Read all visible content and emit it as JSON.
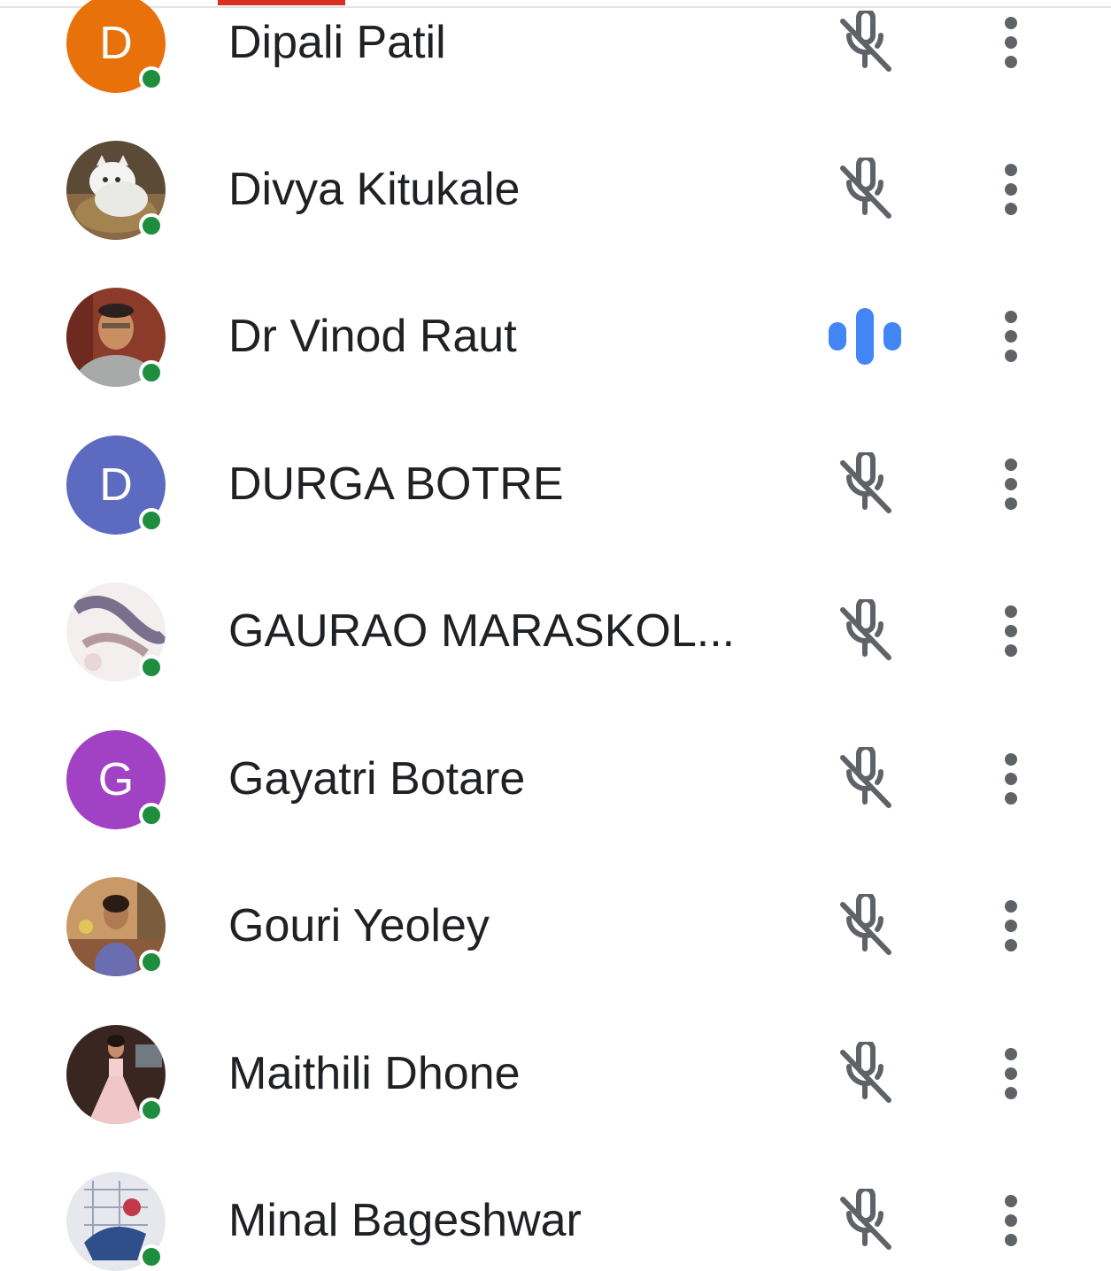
{
  "participants": [
    {
      "name": "Dipali Patil",
      "avatar_type": "initial",
      "initial": "D",
      "avatar_color": "#e8710a",
      "mic": "muted-icon",
      "online": true
    },
    {
      "name": "Divya Kitukale",
      "avatar_type": "photo",
      "photo": "white-kitten-photo",
      "mic": "muted-icon",
      "online": true
    },
    {
      "name": "Dr Vinod Raut",
      "avatar_type": "photo",
      "photo": "man-portrait-photo",
      "mic": "speaking-icon",
      "online": true
    },
    {
      "name": "DURGA BOTRE",
      "avatar_type": "initial",
      "initial": "D",
      "avatar_color": "#5c6bc0",
      "mic": "muted-icon",
      "online": true
    },
    {
      "name": "GAURAO MARASKOL...",
      "avatar_type": "photo",
      "photo": "abstract-photo",
      "mic": "muted-icon",
      "online": true
    },
    {
      "name": "Gayatri Botare",
      "avatar_type": "initial",
      "initial": "G",
      "avatar_color": "#a142c4",
      "mic": "muted-icon",
      "online": true
    },
    {
      "name": "Gouri Yeoley",
      "avatar_type": "photo",
      "photo": "girl-portrait-photo",
      "mic": "muted-icon",
      "online": true
    },
    {
      "name": "Maithili Dhone",
      "avatar_type": "photo",
      "photo": "girl-pink-dress-photo",
      "mic": "muted-icon",
      "online": true
    },
    {
      "name": "Minal Bageshwar",
      "avatar_type": "photo",
      "photo": "drawing-photo",
      "mic": "muted-icon",
      "online": true
    }
  ],
  "colors": {
    "online": "#1e8e3e",
    "speaking": "#4285f4",
    "icon_gray": "#5f6368",
    "text": "#202124",
    "tab_indicator": "#d93025"
  }
}
